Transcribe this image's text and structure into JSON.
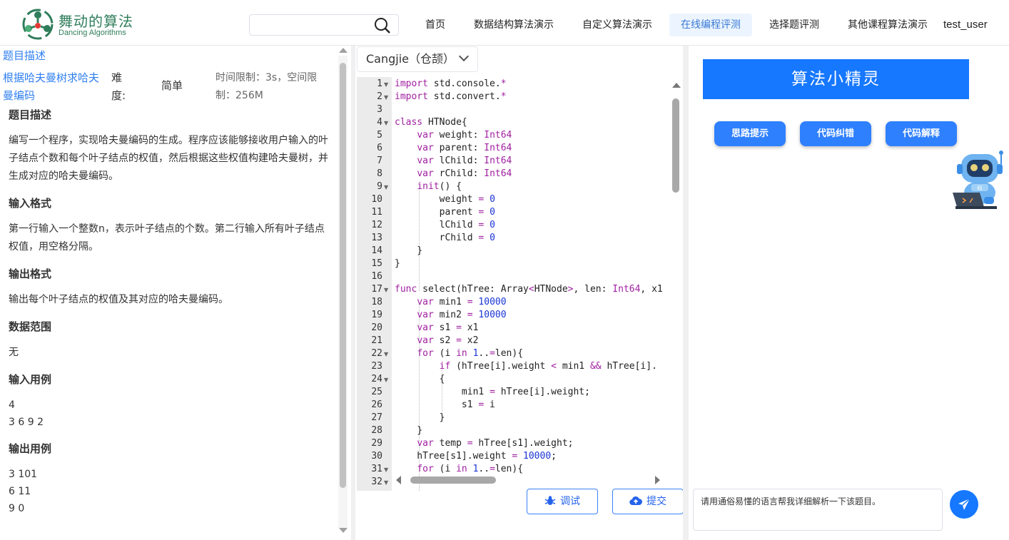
{
  "header": {
    "logo_cn": "舞动的算法",
    "logo_en": "Dancing Algorithms",
    "search_placeholder": "",
    "nav": [
      "首页",
      "数据结构算法演示",
      "自定义算法演示",
      "在线编程评测",
      "选择题评测",
      "其他课程算法演示"
    ],
    "active_nav": "在线编程评测",
    "user": "test_user"
  },
  "problem": {
    "tab": "题目描述",
    "name": "根据哈夫曼树求哈夫曼编码",
    "difficulty_label": "难度:",
    "difficulty": "简单",
    "limits": "时间限制：3s，空间限制：256M",
    "sections": {
      "desc_h": "题目描述",
      "desc": "编写一个程序，实现哈夫曼编码的生成。程序应该能够接收用户输入的叶子结点个数和每个叶子结点的权值，然后根据这些权值构建哈夫曼树，并生成对应的哈夫曼编码。",
      "input_h": "输入格式",
      "input": "第一行输入一个整数n，表示叶子结点的个数。第二行输入所有叶子结点权值，用空格分隔。",
      "output_h": "输出格式",
      "output": "输出每个叶子结点的权值及其对应的哈夫曼编码。",
      "range_h": "数据范围",
      "range": "无",
      "sample_in_h": "输入用例",
      "sample_in": "4\n3 6 9 2",
      "sample_out_h": "输出用例",
      "sample_out": "3 101\n6 11\n9 0"
    }
  },
  "editor": {
    "language": "Cangjie（仓颉）",
    "line_numbers": [
      "1",
      "2",
      "3",
      "4",
      "5",
      "6",
      "7",
      "8",
      "9",
      "10",
      "11",
      "12",
      "13",
      "14",
      "15",
      "16",
      "17",
      "18",
      "19",
      "20",
      "21",
      "22",
      "23",
      "24",
      "25",
      "26",
      "27",
      "28",
      "29",
      "30",
      "31",
      "32"
    ],
    "debug_label": "调试",
    "submit_label": "提交"
  },
  "assistant": {
    "title": "算法小精灵",
    "buttons": [
      "思路提示",
      "代码纠错",
      "代码解释"
    ],
    "robot_badge": "码",
    "input_text": "请用通俗易懂的语言帮我详细解析一下该题目。"
  }
}
